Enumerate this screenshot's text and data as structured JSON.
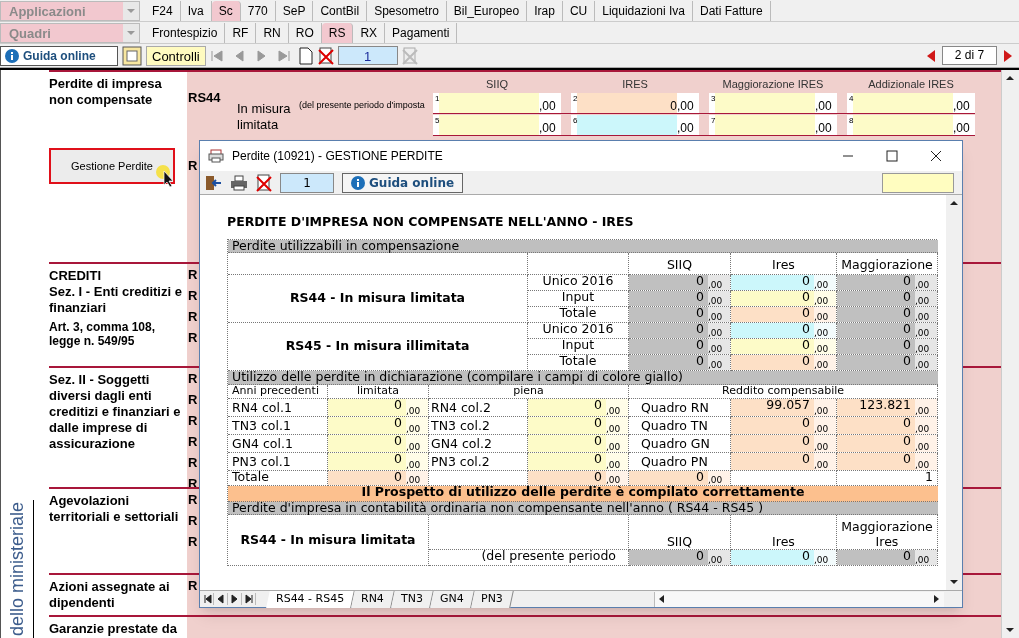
{
  "menus": {
    "applicazioni": "Applicazioni",
    "quadri": "Quadri"
  },
  "app_tabs": [
    {
      "label": "F24",
      "selected": false
    },
    {
      "label": "Iva",
      "selected": false
    },
    {
      "label": "Sc",
      "selected": true
    },
    {
      "label": "770",
      "selected": false
    },
    {
      "label": "SeP",
      "selected": false
    },
    {
      "label": "ContBil",
      "selected": false
    },
    {
      "label": "Spesometro",
      "selected": false
    },
    {
      "label": "Bil_Europeo",
      "selected": false
    },
    {
      "label": "Irap",
      "selected": false
    },
    {
      "label": "CU",
      "selected": false
    },
    {
      "label": "Liquidazioni Iva",
      "selected": false
    },
    {
      "label": "Dati Fatture",
      "selected": false
    }
  ],
  "quadri_tabs": [
    {
      "label": "Frontespizio",
      "selected": false
    },
    {
      "label": "RF",
      "selected": false
    },
    {
      "label": "RN",
      "selected": false
    },
    {
      "label": "RO",
      "selected": false
    },
    {
      "label": "RS",
      "selected": true
    },
    {
      "label": "RX",
      "selected": false
    },
    {
      "label": "Pagamenti",
      "selected": false
    }
  ],
  "toolbar": {
    "help": "Guida online",
    "controls": "Controlli",
    "page": "1",
    "page_of": "2 di 7"
  },
  "form": {
    "vertical_label": "dello ministeriale",
    "button": "Gestione Perdite",
    "rs44": {
      "code": "RS44",
      "columns": [
        "SIIQ",
        "IRES",
        "Maggiorazione IRES",
        "Addizionale IRES"
      ],
      "label": "In misura limitata",
      "note": "(del presente periodo d'imposta",
      "fields": [
        [
          {
            "number": "1",
            "cents": ",00",
            "kind": "input"
          },
          {
            "number": "2",
            "value": "0",
            "cents": ",00",
            "kind": "total"
          },
          {
            "number": "3",
            "cents": ",00",
            "kind": "input"
          },
          {
            "number": "4",
            "cents": ",00",
            "kind": "input"
          }
        ],
        [
          {
            "number": "5",
            "cents": ",00",
            "kind": "input"
          },
          {
            "number": "6",
            "cents": ",00",
            "kind": "imported"
          },
          {
            "number": "7",
            "cents": ",00",
            "kind": "input"
          },
          {
            "number": "8",
            "cents": ",00",
            "kind": "input"
          }
        ]
      ]
    },
    "sections": [
      {
        "title": "Perdite di impresa non compensate",
        "codes": [
          "R"
        ]
      },
      {
        "title": "CREDITI",
        "subtitle": "Sez. I - Enti creditizi e finanziari",
        "note": "Art. 3, comma 108, legge n. 549/95",
        "codes": [
          "R",
          "R",
          "R",
          "R"
        ]
      },
      {
        "title": "Sez. II - Soggetti diversi dagli enti creditizi e finanziari e dalle imprese di assicurazione",
        "codes": [
          "R",
          "R",
          "R",
          "R",
          "R",
          "R"
        ]
      },
      {
        "title": "Agevolazioni territoriali e settoriali",
        "codes": [
          "R",
          "R",
          "R"
        ]
      },
      {
        "title": "Azioni assegnate ai dipendenti",
        "codes": [
          "R"
        ]
      },
      {
        "title": "Garanzie prestate da"
      }
    ]
  },
  "dialog": {
    "title": "Perdite (10921) - GESTIONE PERDITE",
    "page": "1",
    "help": "Guida online",
    "heading": "PERDITE D'IMPRESA NON COMPENSATE NELL'ANNO - IRES",
    "summary": {
      "band": "Perdite utilizzabili in compensazione",
      "columns": [
        "SIIQ",
        "Ires",
        "Maggiorazione"
      ],
      "groups": [
        {
          "label": "RS44 - In misura limitata",
          "rows": [
            {
              "label": "Unico 2016",
              "cells": [
                {
                  "value": "0",
                  "cents": ",00",
                  "kind": "computed"
                },
                {
                  "value": "0",
                  "cents": ",00",
                  "kind": "imported"
                },
                {
                  "value": "0",
                  "cents": ",00",
                  "kind": "computed"
                }
              ]
            },
            {
              "label": "Input",
              "cells": [
                {
                  "value": "0",
                  "cents": ",00",
                  "kind": "computed"
                },
                {
                  "value": "0",
                  "cents": ",00",
                  "kind": "input"
                },
                {
                  "value": "0",
                  "cents": ",00",
                  "kind": "computed"
                }
              ]
            },
            {
              "label": "Totale",
              "cells": [
                {
                  "value": "0",
                  "cents": ",00",
                  "kind": "computed"
                },
                {
                  "value": "0",
                  "cents": ",00",
                  "kind": "total"
                },
                {
                  "value": "0",
                  "cents": ",00",
                  "kind": "computed"
                }
              ]
            }
          ]
        },
        {
          "label": "RS45 - In misura illimitata",
          "rows": [
            {
              "label": "Unico 2016",
              "cells": [
                {
                  "value": "0",
                  "cents": ",00",
                  "kind": "computed"
                },
                {
                  "value": "0",
                  "cents": ",00",
                  "kind": "imported"
                },
                {
                  "value": "0",
                  "cents": ",00",
                  "kind": "computed"
                }
              ]
            },
            {
              "label": "Input",
              "cells": [
                {
                  "value": "0",
                  "cents": ",00",
                  "kind": "computed"
                },
                {
                  "value": "0",
                  "cents": ",00",
                  "kind": "input"
                },
                {
                  "value": "0",
                  "cents": ",00",
                  "kind": "computed"
                }
              ]
            },
            {
              "label": "Totale",
              "cells": [
                {
                  "value": "0",
                  "cents": ",00",
                  "kind": "computed"
                },
                {
                  "value": "0",
                  "cents": ",00",
                  "kind": "total"
                },
                {
                  "value": "0",
                  "cents": ",00",
                  "kind": "computed"
                }
              ]
            }
          ]
        }
      ]
    },
    "usage": {
      "band": "Utilizzo delle perdite in dichiarazione (compilare i campi di colore giallo)",
      "headers": [
        "Anni precedenti",
        "limitata",
        "piena",
        "Reddito compensabile"
      ],
      "rows": [
        {
          "label_1": "RN4 col.1",
          "limitata": {
            "value": "0",
            "cents": ",00",
            "kind": "input"
          },
          "label_2": "RN4 col.2",
          "piena": {
            "value": "0",
            "cents": ",00",
            "kind": "input"
          },
          "quadro": "Quadro RN",
          "reddito": [
            {
              "value": "99.057",
              "cents": ",00",
              "kind": "total"
            },
            {
              "value": "123.821",
              "cents": ",00",
              "kind": "total"
            }
          ]
        },
        {
          "label_1": "TN3 col.1",
          "limitata": {
            "value": "0",
            "cents": ",00",
            "kind": "input"
          },
          "label_2": "TN3 col.2",
          "piena": {
            "value": "0",
            "cents": ",00",
            "kind": "input"
          },
          "quadro": "Quadro TN",
          "reddito": [
            {
              "value": "0",
              "cents": ",00",
              "kind": "total"
            },
            {
              "value": "0",
              "cents": ",00",
              "kind": "total"
            }
          ]
        },
        {
          "label_1": "GN4 col.1",
          "limitata": {
            "value": "0",
            "cents": ",00",
            "kind": "input"
          },
          "label_2": "GN4 col.2",
          "piena": {
            "value": "0",
            "cents": ",00",
            "kind": "input"
          },
          "quadro": "Quadro GN",
          "reddito": [
            {
              "value": "0",
              "cents": ",00",
              "kind": "total"
            },
            {
              "value": "0",
              "cents": ",00",
              "kind": "total"
            }
          ]
        },
        {
          "label_1": "PN3 col.1",
          "limitata": {
            "value": "0",
            "cents": ",00",
            "kind": "input"
          },
          "label_2": "PN3 col.2",
          "piena": {
            "value": "0",
            "cents": ",00",
            "kind": "input"
          },
          "quadro": "Quadro PN",
          "reddito": [
            {
              "value": "0",
              "cents": ",00",
              "kind": "total"
            },
            {
              "value": "0",
              "cents": ",00",
              "kind": "total"
            }
          ]
        }
      ],
      "total": {
        "label": "Totale",
        "limitata": {
          "value": "0",
          "cents": ",00",
          "kind": "total"
        },
        "piena": {
          "value": "0",
          "cents": ",00",
          "kind": "total"
        },
        "reddito": {
          "value": "0",
          "cents": ",00",
          "kind": "total"
        },
        "flag": "1"
      }
    },
    "status": "Il Prospetto di utilizzo delle perdite è compilato correttamente",
    "ordinary": {
      "band": "Perdite d'impresa in contabilità ordinaria non compensante nell'anno ( RS44 - RS45 )",
      "group_label": "RS44 - In misura limitata",
      "columns": [
        "SIIQ",
        "Ires",
        "Maggiorazione Ires"
      ],
      "rows": [
        {
          "label": "(del presente periodo",
          "cells": [
            {
              "value": "0",
              "cents": ",00",
              "kind": "computed"
            },
            {
              "value": "0",
              "cents": ",00",
              "kind": "imported"
            },
            {
              "value": "0",
              "cents": ",00",
              "kind": "computed"
            }
          ]
        }
      ]
    },
    "sheets": [
      {
        "label": "RS44 - RS45",
        "selected": true
      },
      {
        "label": "RN4",
        "selected": false
      },
      {
        "label": "TN3",
        "selected": false
      },
      {
        "label": "GN4",
        "selected": false
      },
      {
        "label": "PN3",
        "selected": false
      }
    ]
  }
}
